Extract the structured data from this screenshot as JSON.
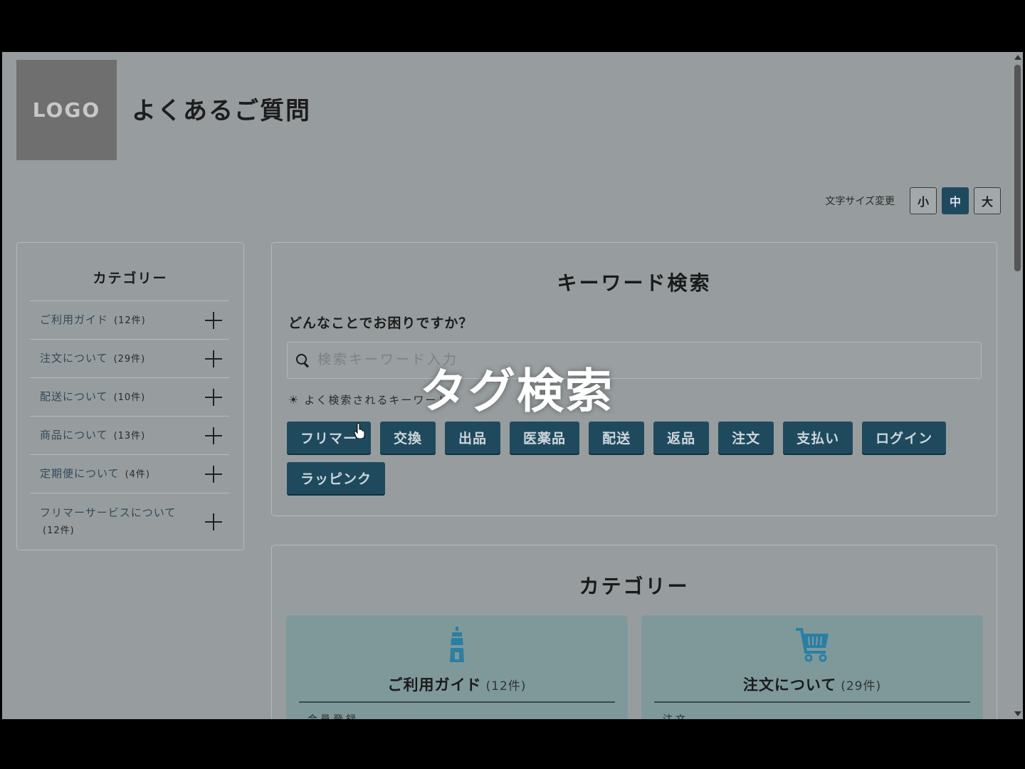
{
  "header": {
    "logo_text": "LOGO",
    "page_title": "よくあるご質問"
  },
  "font_size": {
    "label": "文字サイズ変更",
    "small": "小",
    "medium": "中",
    "large": "大",
    "selected": "中"
  },
  "sidebar": {
    "title": "カテゴリー",
    "items": [
      {
        "label": "ご利用ガイド",
        "count": "(12件)"
      },
      {
        "label": "注文について",
        "count": "(29件)"
      },
      {
        "label": "配送について",
        "count": "(10件)"
      },
      {
        "label": "商品について",
        "count": "(13件)"
      },
      {
        "label": "定期便について",
        "count": "(4件)"
      },
      {
        "label": "フリマーサービスについて",
        "count": "(12件)"
      }
    ]
  },
  "keyword_search": {
    "title": "キーワード検索",
    "question": "どんなことでお困りですか？",
    "placeholder": "検索キーワード入力",
    "popular_label": "よく検索されるキーワード",
    "tags": [
      "フリマー",
      "交換",
      "出品",
      "医薬品",
      "配送",
      "返品",
      "注文",
      "支払い",
      "ログイン",
      "ラッピンク"
    ]
  },
  "overlay": {
    "caption": "タグ検索"
  },
  "categories": {
    "title": "カテゴリー",
    "cards": [
      {
        "name": "ご利用ガイド",
        "count": "(12件)",
        "icon": "lighthouse-icon",
        "first_item": "会員登録"
      },
      {
        "name": "注文について",
        "count": "(29件)",
        "icon": "cart-icon",
        "first_item": "注文"
      }
    ]
  },
  "colors": {
    "accent": "#1f4a5e",
    "page_bg": "#979d9e",
    "card_bg": "#7f999b",
    "icon_accent": "#2a7fa3"
  }
}
